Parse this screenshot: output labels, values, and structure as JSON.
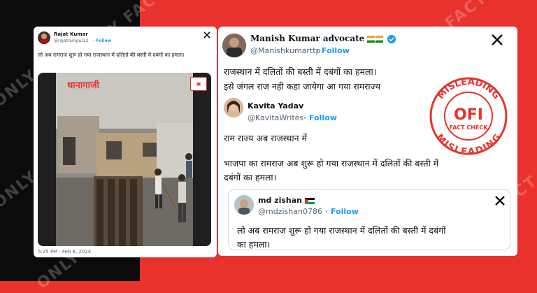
{
  "watermark": "ONLY FACT",
  "tweet1": {
    "name": "Rajat Kumar",
    "handle": "@rajatrampur22",
    "follow": "Follow",
    "text": "लो अब रामराज शुरू हो गया राजस्थान में दलितों की बस्ती में दबंगों का हमला।",
    "video_tag": "थानागाजी",
    "timestamp": "5:25 PM · Feb 8, 2024"
  },
  "tweet2": {
    "name": "Manish Kumar advocate",
    "handle": "@Manishkumarttp",
    "follow": "Follow",
    "text_line1": "राजस्थान में दलितों की बस्ती में दबंगों का हमला।",
    "text_line2": "इसे जंगल राज नही कहा जायेगा आ गया रामराज्य",
    "inner": {
      "name": "Kavita Yadav",
      "handle": "@KavitaWrites",
      "follow": "Follow",
      "text_line1": "राम राज्य अब राजस्थान में",
      "text_line2": "भाजपा का रामराज अब शुरू हो गया राजस्थान में दलितों की बस्ती में",
      "text_line3": "दबंगों का हमला।"
    },
    "quote": {
      "name": "md zishan",
      "handle": "@mdzishan0786",
      "follow": "Follow",
      "text_line1": "लो अब रामराज शुरू हो गया राजस्थान में दलितों की बस्ती में दबंगों",
      "text_line2": "का हमला।"
    }
  },
  "stamp": {
    "top": "MISLEADING",
    "bottom": "MISLEADING",
    "logo": "OFI",
    "sub": "FACT CHECK",
    "color": "#e8322b"
  }
}
